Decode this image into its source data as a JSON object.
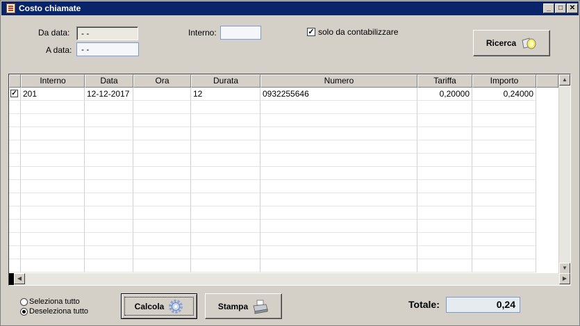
{
  "window": {
    "title": "Costo chiamate",
    "controls": {
      "minimize": "_",
      "maximize": "□",
      "close": "✕"
    }
  },
  "filters": {
    "from_label": "Da data:",
    "from_value": "- -",
    "to_label": "A data:",
    "to_value": "- -",
    "internal_label": "Interno:",
    "internal_value": "",
    "only_to_account_label": "solo da contabilizzare",
    "only_to_account_checked": true,
    "search_button": "Ricerca",
    "search_icon": "flashlight-icon"
  },
  "table": {
    "columns": [
      "Interno",
      "Data",
      "Ora",
      "Durata",
      "Numero",
      "Tariffa",
      "Importo"
    ],
    "rows": [
      {
        "checked": true,
        "cells": [
          "201",
          "12-12-2017",
          "",
          "12",
          "0932255646",
          "0,20000",
          "0,24000"
        ]
      }
    ]
  },
  "selection": {
    "select_all": "Seleziona tutto",
    "deselect_all": "Deseleziona tutto",
    "selected": "deselect_all"
  },
  "actions": {
    "calculate_button": "Calcola",
    "calculate_icon": "gear-icon",
    "print_button": "Stampa",
    "print_icon": "printer-icon"
  },
  "total": {
    "label": "Totale:",
    "value": "0,24"
  }
}
